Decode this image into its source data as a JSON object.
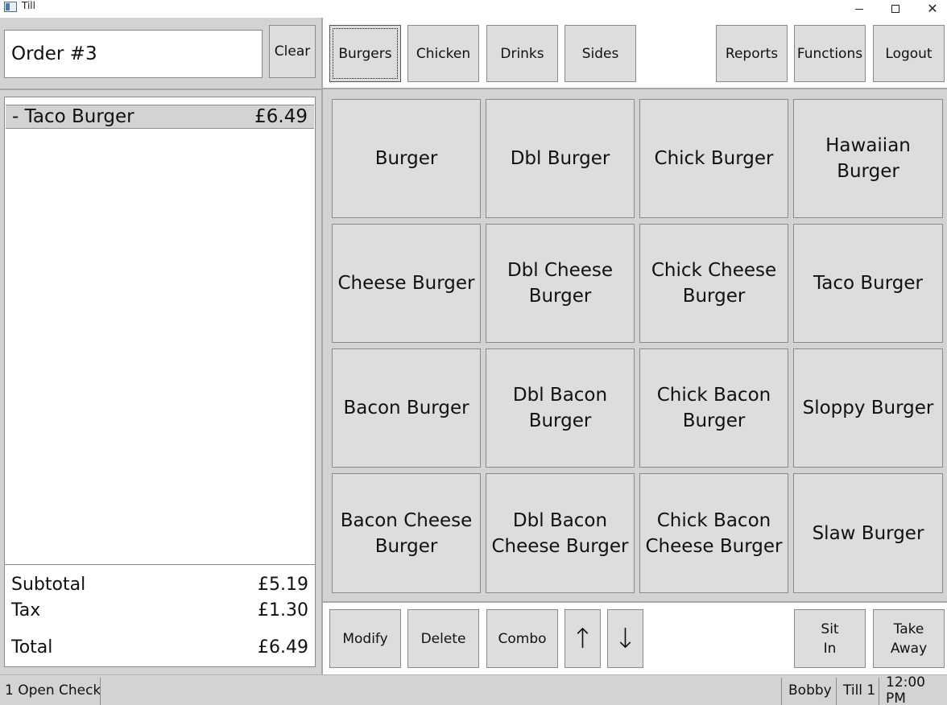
{
  "window": {
    "title": "Till",
    "min_icon": "minimize-icon",
    "max_icon": "maximize-icon",
    "close_icon": "close-icon",
    "close_glyph": "✕"
  },
  "order": {
    "title": "Order #3",
    "clear_label": "Clear"
  },
  "categories": [
    "Burgers",
    "Chicken",
    "Drinks",
    "Sides"
  ],
  "top_actions": [
    "Reports",
    "Functions",
    "Logout"
  ],
  "order_items": [
    {
      "name": "- Taco Burger",
      "price": "£6.49"
    }
  ],
  "totals": {
    "subtotal_label": "Subtotal",
    "subtotal": "£5.19",
    "tax_label": "Tax",
    "tax": "£1.30",
    "total_label": "Total",
    "total": "£6.49"
  },
  "menu_items": [
    "Burger",
    "Dbl Burger",
    "Chick Burger",
    "Hawaiian Burger",
    "Cheese Burger",
    "Dbl Cheese Burger",
    "Chick Cheese Burger",
    "Taco Burger",
    "Bacon Burger",
    "Dbl Bacon Burger",
    "Chick Bacon Burger",
    "Sloppy Burger",
    "Bacon Cheese Burger",
    "Dbl Bacon Cheese Burger",
    "Chick Bacon Cheese Burger",
    "Slaw Burger"
  ],
  "bottom_actions": {
    "modify": "Modify",
    "delete": "Delete",
    "combo": "Combo",
    "up": "↑",
    "down": "↓",
    "sit_in_1": "Sit",
    "sit_in_2": "In",
    "take_away_1": "Take",
    "take_away_2": "Away"
  },
  "status": {
    "open_checks": "1 Open Check",
    "user": "Bobby",
    "till": "Till 1",
    "time": "12:00 PM"
  }
}
